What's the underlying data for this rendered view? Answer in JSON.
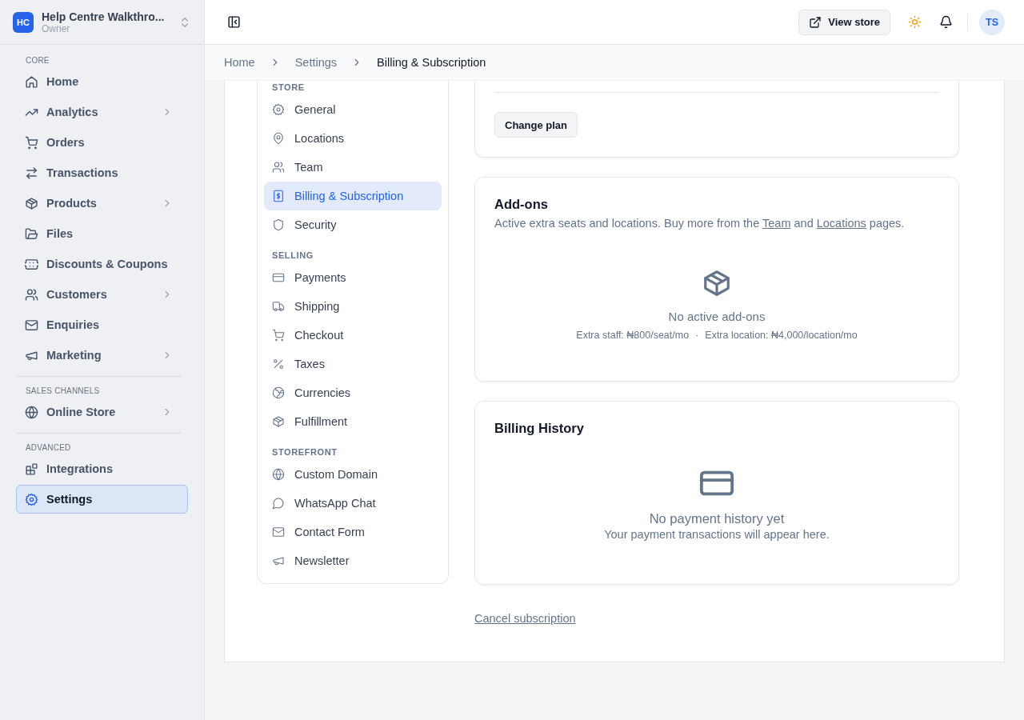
{
  "workspace": {
    "initials": "HC",
    "name": "Help Centre Walkthro...",
    "role": "Owner"
  },
  "sidebar": {
    "sections": [
      {
        "heading": "CORE",
        "items": [
          {
            "label": "Home",
            "has_children": false,
            "selected": false
          },
          {
            "label": "Analytics",
            "has_children": true,
            "selected": false
          },
          {
            "label": "Orders",
            "has_children": false,
            "selected": false
          },
          {
            "label": "Transactions",
            "has_children": false,
            "selected": false
          },
          {
            "label": "Products",
            "has_children": true,
            "selected": false
          },
          {
            "label": "Files",
            "has_children": false,
            "selected": false
          },
          {
            "label": "Discounts & Coupons",
            "has_children": false,
            "selected": false
          },
          {
            "label": "Customers",
            "has_children": true,
            "selected": false
          },
          {
            "label": "Enquiries",
            "has_children": false,
            "selected": false
          },
          {
            "label": "Marketing",
            "has_children": true,
            "selected": false
          }
        ]
      },
      {
        "heading": "SALES CHANNELS",
        "items": [
          {
            "label": "Online Store",
            "has_children": true,
            "selected": false
          }
        ]
      },
      {
        "heading": "ADVANCED",
        "items": [
          {
            "label": "Integrations",
            "has_children": false,
            "selected": false
          },
          {
            "label": "Settings",
            "has_children": false,
            "selected": true
          }
        ]
      }
    ]
  },
  "header": {
    "view_store": "View store",
    "avatar": "TS"
  },
  "breadcrumb": [
    {
      "label": "Home",
      "current": false
    },
    {
      "label": "Settings",
      "current": false
    },
    {
      "label": "Billing & Subscription",
      "current": true
    }
  ],
  "settings_nav": {
    "sections": [
      {
        "heading": "STORE",
        "items": [
          {
            "label": "General",
            "selected": false
          },
          {
            "label": "Locations",
            "selected": false
          },
          {
            "label": "Team",
            "selected": false
          },
          {
            "label": "Billing & Subscription",
            "selected": true
          },
          {
            "label": "Security",
            "selected": false
          }
        ]
      },
      {
        "heading": "SELLING",
        "items": [
          {
            "label": "Payments",
            "selected": false
          },
          {
            "label": "Shipping",
            "selected": false
          },
          {
            "label": "Checkout",
            "selected": false
          },
          {
            "label": "Taxes",
            "selected": false
          },
          {
            "label": "Currencies",
            "selected": false
          },
          {
            "label": "Fulfillment",
            "selected": false
          }
        ]
      },
      {
        "heading": "STOREFRONT",
        "items": [
          {
            "label": "Custom Domain",
            "selected": false
          },
          {
            "label": "WhatsApp Chat",
            "selected": false
          },
          {
            "label": "Contact Form",
            "selected": false
          },
          {
            "label": "Newsletter",
            "selected": false
          }
        ]
      }
    ]
  },
  "plan_card": {
    "button": "Change plan"
  },
  "addons_card": {
    "title": "Add-ons",
    "description": [
      {
        "kind": "text",
        "text": "Active extra seats and locations. Buy more from the "
      },
      {
        "kind": "link",
        "text": "Team"
      },
      {
        "kind": "text",
        "text": " and "
      },
      {
        "kind": "link",
        "text": "Locations"
      },
      {
        "kind": "text",
        "text": " pages."
      }
    ],
    "empty_title": "No active add-ons",
    "pricing": [
      "Extra staff: ₦800/seat/mo",
      "Extra location: ₦4,000/location/mo"
    ],
    "separator": "·"
  },
  "billing_card": {
    "title": "Billing History",
    "empty_title": "No payment history yet",
    "empty_message": "Your payment transactions will appear here."
  },
  "cancel_link": "Cancel subscription"
}
